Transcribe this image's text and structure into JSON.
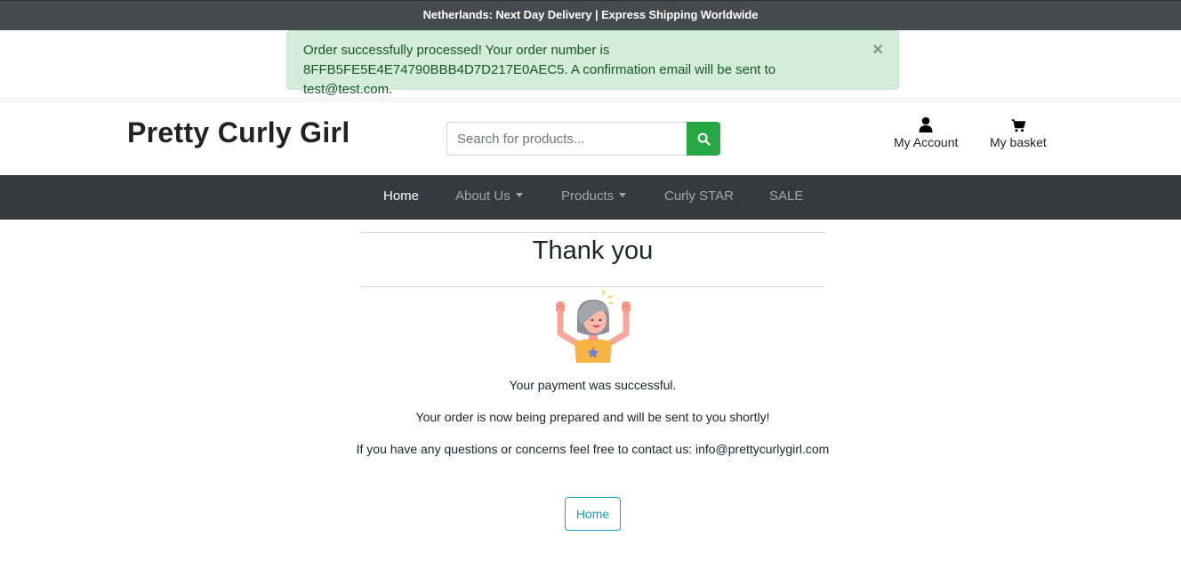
{
  "announcement": "Netherlands: Next Day Delivery | Express Shipping Worldwide",
  "alert": {
    "message": "Order successfully processed! Your order number is 8FFB5FE5E4E74790BBB4D7D217E0AEC5. A confirmation email will be sent to test@test.com.",
    "close_label": "×",
    "colors": {
      "background": "#d4edda",
      "text": "#155724"
    }
  },
  "header": {
    "brand": "Pretty Curly Girl",
    "search": {
      "placeholder": "Search for products...",
      "value": "",
      "button_icon": "search-icon"
    },
    "account": {
      "label": "My Account",
      "icon": "user-icon"
    },
    "basket": {
      "label": "My basket",
      "icon": "cart-icon"
    }
  },
  "nav": {
    "items": [
      {
        "label": "Home",
        "active": true
      },
      {
        "label": "About Us",
        "dropdown": true
      },
      {
        "label": "Products",
        "dropdown": true
      },
      {
        "label": "Curly STAR"
      },
      {
        "label": "SALE"
      }
    ]
  },
  "main": {
    "title": "Thank you",
    "illustration": "celebrating-girl-illustration",
    "lines": [
      "Your payment was successful.",
      "Your order is now being prepared and will be sent to you shortly!",
      "If you have any questions or concerns feel free to contact us: info@prettycurlygirl.com"
    ],
    "home_button": "Home"
  },
  "colors": {
    "accent_green": "#28a745",
    "navbar": "#343a40",
    "topbar": "#454a4f",
    "info": "#17a2b8"
  }
}
